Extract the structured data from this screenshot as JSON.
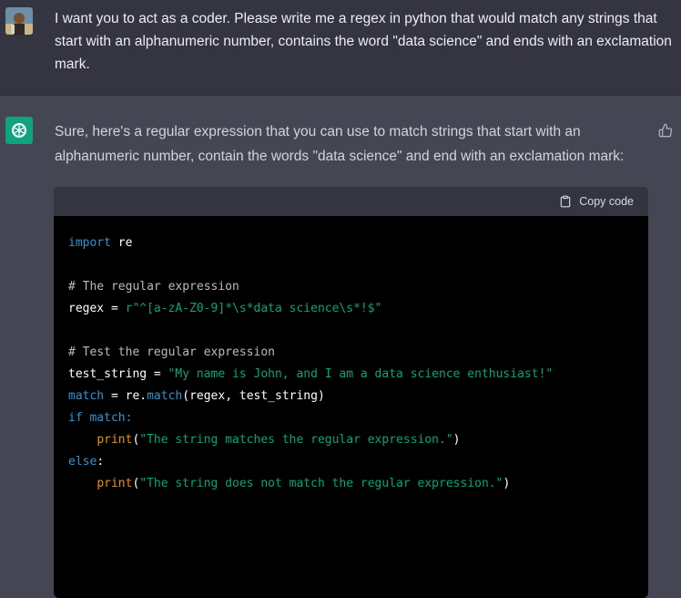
{
  "user_message": {
    "text": "I want you to act as a coder. Please write me a regex in python that would match any strings that start with an alphanumeric number, contains the word \"data science\" and ends with an exclamation mark."
  },
  "assistant_message": {
    "text": "Sure, here's a regular expression that you can use to match strings that start with an alphanumeric number, contain the words \"data science\" and end with an exclamation mark:",
    "code_block": {
      "copy_label": "Copy code",
      "lines": [
        {
          "import_kw": "import",
          "module": " re"
        },
        {
          "comment1": "# The regular expression"
        },
        {
          "var": "regex",
          "eq": " = ",
          "str": "r\"^[a-zA-Z0-9]*\\s*data science\\s*!$\""
        },
        {
          "comment2": "# Test the regular expression"
        },
        {
          "var": "test_string",
          "eq": " = ",
          "str": "\"My name is John, and I am a data science enthusiast!\""
        },
        {
          "var": "match",
          "eq": " = ",
          "obj": "re.",
          "fn": "match",
          "args": "(regex, test_string)"
        },
        {
          "kw": "if",
          "rest": " match:"
        },
        {
          "bi": "print",
          "str": "\"The string matches the regular expression.\"",
          "close": ")"
        },
        {
          "kw": "else",
          "rest": ":"
        },
        {
          "bi": "print",
          "str": "\"The string does not match the regular expression.\"",
          "close": ")"
        }
      ]
    }
  },
  "colors": {
    "user_bg": "#343541",
    "assistant_bg": "#444654",
    "brand_green": "#10a37f",
    "code_bg": "#000000",
    "keyword": "#2e95d3",
    "string": "#00a67d",
    "builtin": "#e9950c"
  },
  "icons": [
    "user-avatar",
    "openai-logo-icon",
    "thumbs-up-icon",
    "clipboard-icon"
  ]
}
